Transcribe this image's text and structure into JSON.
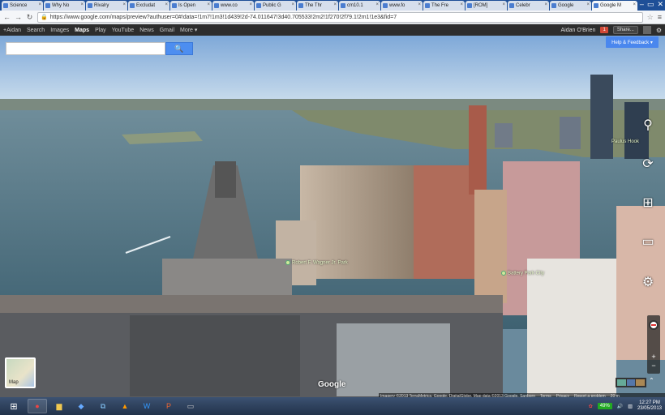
{
  "tabs": [
    {
      "label": "Science",
      "active": false
    },
    {
      "label": "Why No",
      "active": false
    },
    {
      "label": "Rivalry",
      "active": false
    },
    {
      "label": "Excludat",
      "active": false
    },
    {
      "label": "Is Open",
      "active": false
    },
    {
      "label": "www.co",
      "active": false
    },
    {
      "label": "Public G",
      "active": false
    },
    {
      "label": "The Thr",
      "active": false
    },
    {
      "label": "cm10.1",
      "active": false
    },
    {
      "label": "www.fo",
      "active": false
    },
    {
      "label": "The Fre",
      "active": false
    },
    {
      "label": "[ROM]",
      "active": false
    },
    {
      "label": "Celebr",
      "active": false
    },
    {
      "label": "Google",
      "active": false
    },
    {
      "label": "Google M",
      "active": true
    }
  ],
  "address_bar": {
    "url": "https://www.google.com/maps/preview?authuser=0#!data=!1m7!1m3!1d439!2d-74.011647!3d40.705533!2m2!1f270!2f79.1!2m1!1e3&fid=7"
  },
  "gbar": {
    "links": [
      "+Aidan",
      "Search",
      "Images",
      "Maps",
      "Play",
      "YouTube",
      "News",
      "Gmail",
      "More ▾"
    ],
    "active": "Maps",
    "user": "Aidan O'Brien",
    "notifications": "1",
    "share": "Share..."
  },
  "map": {
    "search_placeholder": "",
    "help_label": "Help & Feedback ▾",
    "minimap_label": "Map",
    "logo": "Google",
    "poi": [
      {
        "label": "Robert F. Wagner Jr. Park"
      },
      {
        "label": "Battery Park City"
      },
      {
        "label": "Paulus Hook"
      }
    ],
    "attribution": [
      "Imagery ©2013 TerraMetrics, Google, DigitalGlobe, Map data ©2013 Google, Sanborn",
      "Terms",
      "Privacy",
      "Report a problem",
      "20 m"
    ]
  },
  "taskbar": {
    "apps": [
      "chrome",
      "explorer",
      "virtualbox",
      "network",
      "vlc",
      "word",
      "powerpoint",
      "window"
    ],
    "battery": "49%",
    "time": "12:27 PM",
    "date": "23/05/2013"
  },
  "colors": {
    "sky": "#aecbe8",
    "water": "#5e7f8f",
    "accent_blue": "#4d8ef0",
    "gbar": "#2d2d2d"
  }
}
